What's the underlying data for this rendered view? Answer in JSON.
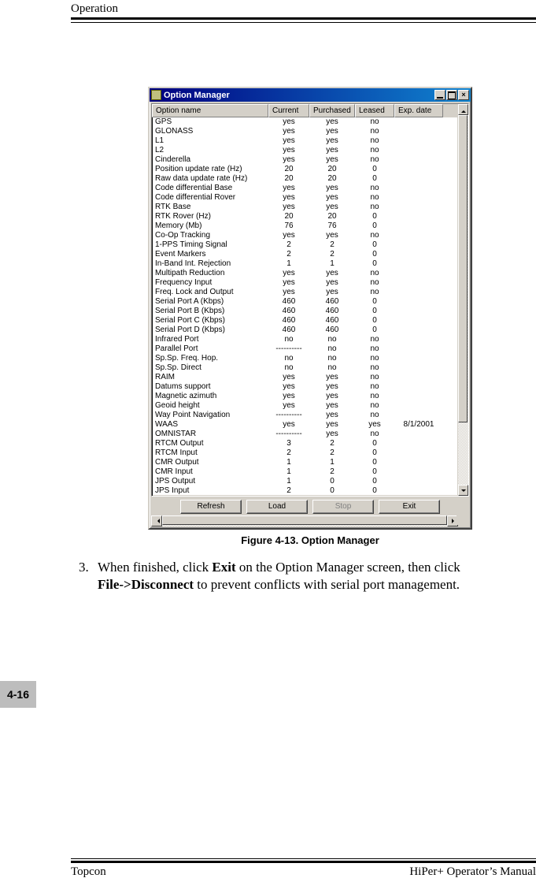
{
  "header": {
    "section": "Operation"
  },
  "dialog": {
    "title": "Option Manager",
    "columns": [
      "Option name",
      "Current",
      "Purchased",
      "Leased",
      "Exp. date"
    ],
    "rows": [
      {
        "name": "GPS",
        "current": "yes",
        "purchased": "yes",
        "leased": "no",
        "exp": ""
      },
      {
        "name": "GLONASS",
        "current": "yes",
        "purchased": "yes",
        "leased": "no",
        "exp": ""
      },
      {
        "name": "L1",
        "current": "yes",
        "purchased": "yes",
        "leased": "no",
        "exp": ""
      },
      {
        "name": "L2",
        "current": "yes",
        "purchased": "yes",
        "leased": "no",
        "exp": ""
      },
      {
        "name": "Cinderella",
        "current": "yes",
        "purchased": "yes",
        "leased": "no",
        "exp": ""
      },
      {
        "name": "Position update rate (Hz)",
        "current": "20",
        "purchased": "20",
        "leased": "0",
        "exp": ""
      },
      {
        "name": "Raw data update rate (Hz)",
        "current": "20",
        "purchased": "20",
        "leased": "0",
        "exp": ""
      },
      {
        "name": "Code differential Base",
        "current": "yes",
        "purchased": "yes",
        "leased": "no",
        "exp": ""
      },
      {
        "name": "Code differential Rover",
        "current": "yes",
        "purchased": "yes",
        "leased": "no",
        "exp": ""
      },
      {
        "name": "RTK Base",
        "current": "yes",
        "purchased": "yes",
        "leased": "no",
        "exp": ""
      },
      {
        "name": "RTK Rover (Hz)",
        "current": "20",
        "purchased": "20",
        "leased": "0",
        "exp": ""
      },
      {
        "name": "Memory (Mb)",
        "current": "76",
        "purchased": "76",
        "leased": "0",
        "exp": ""
      },
      {
        "name": "Co-Op Tracking",
        "current": "yes",
        "purchased": "yes",
        "leased": "no",
        "exp": ""
      },
      {
        "name": "1-PPS Timing Signal",
        "current": "2",
        "purchased": "2",
        "leased": "0",
        "exp": ""
      },
      {
        "name": "Event Markers",
        "current": "2",
        "purchased": "2",
        "leased": "0",
        "exp": ""
      },
      {
        "name": "In-Band Int. Rejection",
        "current": "1",
        "purchased": "1",
        "leased": "0",
        "exp": ""
      },
      {
        "name": "Multipath Reduction",
        "current": "yes",
        "purchased": "yes",
        "leased": "no",
        "exp": ""
      },
      {
        "name": "Frequency Input",
        "current": "yes",
        "purchased": "yes",
        "leased": "no",
        "exp": ""
      },
      {
        "name": "Freq. Lock and Output",
        "current": "yes",
        "purchased": "yes",
        "leased": "no",
        "exp": ""
      },
      {
        "name": "Serial Port A (Kbps)",
        "current": "460",
        "purchased": "460",
        "leased": "0",
        "exp": ""
      },
      {
        "name": "Serial Port B (Kbps)",
        "current": "460",
        "purchased": "460",
        "leased": "0",
        "exp": ""
      },
      {
        "name": "Serial Port C (Kbps)",
        "current": "460",
        "purchased": "460",
        "leased": "0",
        "exp": ""
      },
      {
        "name": "Serial Port D (Kbps)",
        "current": "460",
        "purchased": "460",
        "leased": "0",
        "exp": ""
      },
      {
        "name": "Infrared Port",
        "current": "no",
        "purchased": "no",
        "leased": "no",
        "exp": ""
      },
      {
        "name": "Parallel Port",
        "current": "----------",
        "purchased": "no",
        "leased": "no",
        "exp": ""
      },
      {
        "name": "Sp.Sp. Freq. Hop.",
        "current": "no",
        "purchased": "no",
        "leased": "no",
        "exp": ""
      },
      {
        "name": "Sp.Sp. Direct",
        "current": "no",
        "purchased": "no",
        "leased": "no",
        "exp": ""
      },
      {
        "name": "RAIM",
        "current": "yes",
        "purchased": "yes",
        "leased": "no",
        "exp": ""
      },
      {
        "name": "Datums support",
        "current": "yes",
        "purchased": "yes",
        "leased": "no",
        "exp": ""
      },
      {
        "name": "Magnetic azimuth",
        "current": "yes",
        "purchased": "yes",
        "leased": "no",
        "exp": ""
      },
      {
        "name": "Geoid height",
        "current": "yes",
        "purchased": "yes",
        "leased": "no",
        "exp": ""
      },
      {
        "name": "Way Point Navigation",
        "current": "----------",
        "purchased": "yes",
        "leased": "no",
        "exp": ""
      },
      {
        "name": "WAAS",
        "current": "yes",
        "purchased": "yes",
        "leased": "yes",
        "exp": "8/1/2001"
      },
      {
        "name": "OMNISTAR",
        "current": "----------",
        "purchased": "yes",
        "leased": "no",
        "exp": ""
      },
      {
        "name": "RTCM Output",
        "current": "3",
        "purchased": "2",
        "leased": "0",
        "exp": ""
      },
      {
        "name": "RTCM Input",
        "current": "2",
        "purchased": "2",
        "leased": "0",
        "exp": ""
      },
      {
        "name": "CMR Output",
        "current": "1",
        "purchased": "1",
        "leased": "0",
        "exp": ""
      },
      {
        "name": "CMR Input",
        "current": "1",
        "purchased": "2",
        "leased": "0",
        "exp": ""
      },
      {
        "name": "JPS Output",
        "current": "1",
        "purchased": "0",
        "leased": "0",
        "exp": ""
      },
      {
        "name": "JPS Input",
        "current": "2",
        "purchased": "0",
        "leased": "0",
        "exp": ""
      }
    ],
    "buttons": {
      "refresh": "Refresh",
      "load": "Load",
      "stop": "Stop",
      "exit": "Exit"
    }
  },
  "caption": "Figure 4-13. Option Manager",
  "step": {
    "num": "3.",
    "pre": "When finished, click ",
    "b1": "Exit",
    "mid": " on the Option Manager screen, then click ",
    "b2": "File->Disconnect",
    "post": " to prevent conflicts with serial port management."
  },
  "pageNumber": "4-16",
  "footer": {
    "left": "Topcon",
    "right": "HiPer+ Operator’s Manual"
  }
}
